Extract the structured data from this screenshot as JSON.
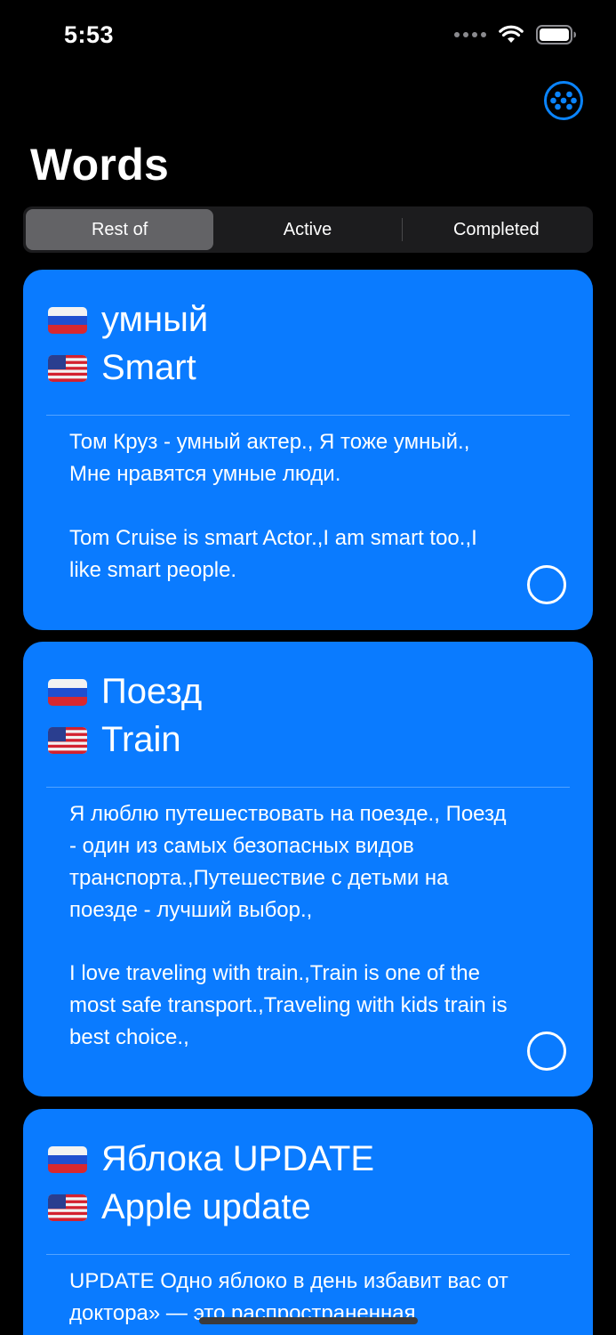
{
  "status_bar": {
    "time": "5:53"
  },
  "header": {
    "title": "Words",
    "action_icon": "grid-dots-icon"
  },
  "segments": [
    {
      "label": "Rest of",
      "selected": true
    },
    {
      "label": "Active",
      "selected": false
    },
    {
      "label": "Completed",
      "selected": false
    }
  ],
  "cards": [
    {
      "ru_word": "умный",
      "en_word": "Smart",
      "ru_example": "Том Круз - умный актер., Я тоже умный., Мне нравятся умные люди.",
      "en_example": "Tom Cruise is smart Actor.,I am smart too.,I like smart people."
    },
    {
      "ru_word": "Поезд",
      "en_word": "Train",
      "ru_example": "Я люблю путешествовать на поезде., Поезд - один из самых безопасных видов транспорта.,Путешествие с детьми на поезде - лучший выбор.,",
      "en_example": "I love traveling with train.,Train is one of the most safe transport.,Traveling with kids train is best choice.,"
    },
    {
      "ru_word": "Яблока UPDATE",
      "en_word": "Apple update",
      "ru_example": "UPDATE Одно яблоко в день избавит вас от доктора» — это распространенная"
    }
  ],
  "colors": {
    "card_blue": "#0a7bff",
    "accent": "#0a84ff",
    "segment_selected": "#636366"
  }
}
